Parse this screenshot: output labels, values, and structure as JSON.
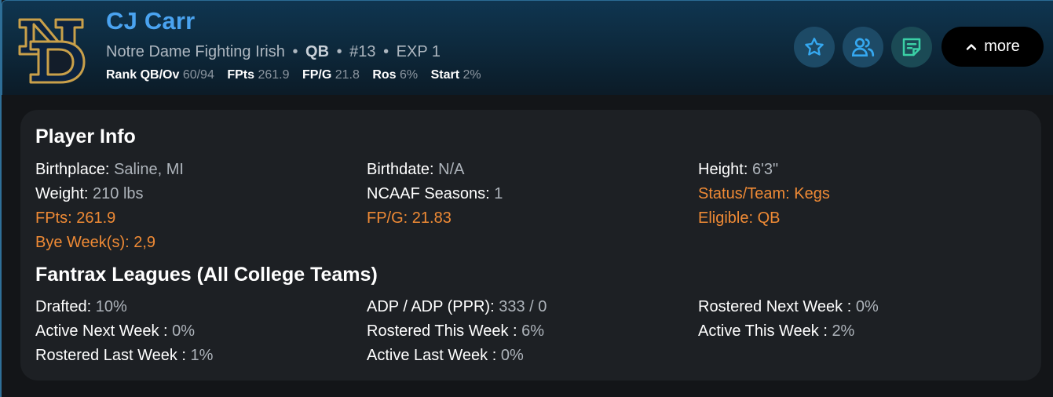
{
  "header": {
    "name": "CJ Carr",
    "team": "Notre Dame Fighting Irish",
    "position": "QB",
    "number": "#13",
    "exp": "EXP 1",
    "separator": "•",
    "stats": [
      {
        "label": "Rank QB/Ov",
        "value": "60/94"
      },
      {
        "label": "FPts",
        "value": "261.9"
      },
      {
        "label": "FP/G",
        "value": "21.8"
      },
      {
        "label": "Ros",
        "value": "6%"
      },
      {
        "label": "Start",
        "value": "2%"
      }
    ],
    "buttons": {
      "favorite_icon": "star-icon",
      "users_icon": "people-icon",
      "notes_icon": "note-icon",
      "more_label": "more"
    }
  },
  "player_info": {
    "title": "Player Info",
    "fields": [
      {
        "label": "Birthplace:",
        "value": "Saline, MI"
      },
      {
        "label": "Birthdate:",
        "value": "N/A"
      },
      {
        "label": "Height:",
        "value": "6'3\""
      },
      {
        "label": "Weight:",
        "value": "210 lbs"
      },
      {
        "label": "NCAAF Seasons:",
        "value": "1"
      },
      {
        "label": "Status/Team:",
        "value": "Kegs"
      },
      {
        "label": "FPts:",
        "value": "261.9"
      },
      {
        "label": "FP/G:",
        "value": "21.83"
      },
      {
        "label": "Eligible:",
        "value": "QB"
      },
      {
        "label": "Bye Week(s):",
        "value": "2,9"
      }
    ]
  },
  "leagues": {
    "title": "Fantrax Leagues (All College Teams)",
    "fields": [
      {
        "label": "Drafted:",
        "value": "10%"
      },
      {
        "label": "ADP / ADP (PPR):",
        "value": "333 / 0"
      },
      {
        "label": "Rostered Next Week :",
        "value": "0%"
      },
      {
        "label": "Active Next Week :",
        "value": "0%"
      },
      {
        "label": "Rostered This Week :",
        "value": "6%"
      },
      {
        "label": "Active This Week :",
        "value": "2%"
      },
      {
        "label": "Rostered Last Week :",
        "value": "1%"
      },
      {
        "label": "Active Last Week :",
        "value": "0%"
      }
    ]
  },
  "colors": {
    "name": "#4aa3f0",
    "highlight": "#ef8a35",
    "logo_gold": "#c9a04a",
    "logo_navy": "#0c2340"
  }
}
